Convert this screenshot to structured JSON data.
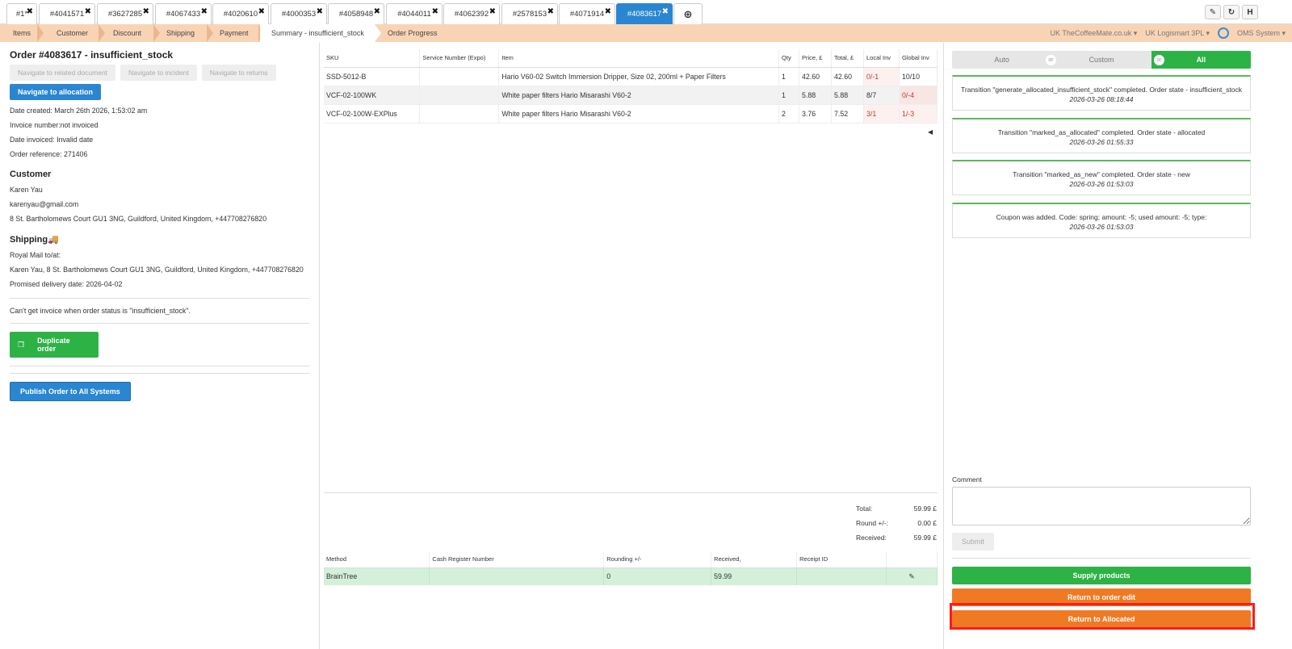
{
  "tabs": [
    {
      "label": "#1*",
      "active": false
    },
    {
      "label": "#4041571",
      "active": false
    },
    {
      "label": "#3627285",
      "active": false
    },
    {
      "label": "#4067433",
      "active": false
    },
    {
      "label": "#4020610",
      "active": false
    },
    {
      "label": "#4000353",
      "active": false
    },
    {
      "label": "#4058948",
      "active": false
    },
    {
      "label": "#4044011",
      "active": false
    },
    {
      "label": "#4062392",
      "active": false
    },
    {
      "label": "#2578153",
      "active": false
    },
    {
      "label": "#4071914",
      "active": false
    },
    {
      "label": "#4083617",
      "active": true
    }
  ],
  "tab_close_glyph": "✖",
  "tab_add_glyph": "⊕",
  "tools": {
    "wrench": "✎",
    "refresh": "↻",
    "help": "H"
  },
  "steps": [
    "Items",
    "Customer",
    "Discount",
    "Shipping",
    "Payment",
    "Summary - insufficient_stock",
    "Order Progress"
  ],
  "topmenu": {
    "shop": "UK TheCoffeeMate.co.uk ▾",
    "warehouse": "UK Logismart 3PL ▾",
    "system": "OMS System ▾"
  },
  "order": {
    "title": "Order #4083617 - insufficient_stock",
    "nav_related": "Navigate to related document",
    "nav_incident": "Navigate to incident",
    "nav_returns": "Navigate to returns",
    "nav_allocation": "Navigate to allocation",
    "date_created": "Date created: March 26th 2026, 1:53:02 am",
    "invoice_number": "Invoice number:not invoiced",
    "date_invoiced": "Date invoiced: Invalid date",
    "order_reference": "Order reference: 271406"
  },
  "customer": {
    "heading": "Customer",
    "name": "Karen Yau",
    "email": "karenyau@gmail.com",
    "address": "8 St. Bartholomews Court GU1 3NG, Guildford, United Kingdom, +447708276820"
  },
  "shipping": {
    "heading": "Shipping",
    "icon": "🚚",
    "method": "Royal Mail to/at:",
    "address": "Karen Yau, 8 St. Bartholomews Court GU1 3NG, Guildford, United Kingdom, +447708276820",
    "promised": "Promised delivery date: 2026-04-02"
  },
  "invoice_msg": "Can't get invoice when order status is \"insufficient_stock\".",
  "duplicate_label": "Duplicate order",
  "publish_label": "Publish Order to All Systems",
  "items_table": {
    "headers": [
      "SKU",
      "Service Number (Expo)",
      "Item",
      "Qty",
      "Price, £",
      "Total, £",
      "Local Inv",
      "Global Inv"
    ],
    "rows": [
      [
        "SSD-5012-B",
        "",
        "Hario V60-02 Switch Immersion Dripper, Size 02, 200ml + Paper Filters",
        "1",
        "42.60",
        "42.60",
        "0/-1",
        "10/10"
      ],
      [
        "VCF-02-100WK",
        "",
        "White paper filters Hario Misarashi V60-2",
        "1",
        "5.88",
        "5.88",
        "8/7",
        "0/-4"
      ],
      [
        "VCF-02-100W-EXPlus",
        "",
        "White paper filters Hario Misarashi V60-2",
        "2",
        "3.76",
        "7.52",
        "3/1",
        "1/-3"
      ]
    ]
  },
  "totals": {
    "total_label": "Total:",
    "total": "59.99 £",
    "round_label": "Round +/-:",
    "round": "0.00 £",
    "received_label": "Received:",
    "received": "59.99 £"
  },
  "payments": {
    "headers": [
      "Method",
      "Cash Register Number",
      "Rounding +/-",
      "Received,",
      "Receipt ID"
    ],
    "row": [
      "BrainTree",
      "",
      "0",
      "59.99",
      ""
    ],
    "edit_icon": "✎"
  },
  "filter": {
    "auto": "Auto",
    "custom": "Custom",
    "all": "All",
    "or": "or"
  },
  "history": [
    {
      "text": "Transition \"generate_allocated_insufficient_stock\" completed. Order state - insufficient_stock",
      "time": "2026-03-26 08:18:44"
    },
    {
      "text": "Transition \"marked_as_allocated\" completed. Order state - allocated",
      "time": "2026-03-26 01:55:33"
    },
    {
      "text": "Transition \"marked_as_new\" completed. Order state - new",
      "time": "2026-03-26 01:53:03"
    },
    {
      "text": "Coupon was added. Code: spring; amount: -5; used amount: -5; type:",
      "time": "2026-03-26 01:53:03"
    }
  ],
  "comment_label": "Comment",
  "submit_label": "Submit",
  "actions": {
    "supply": "Supply products",
    "return_edit": "Return to order edit",
    "return_allocated": "Return to Allocated"
  },
  "colors": {
    "accent_blue": "#2a86d1",
    "green": "#2db246",
    "orange": "#f07a24",
    "steps_bg": "#f9d4b4",
    "highlight": "#ff1a1a"
  }
}
